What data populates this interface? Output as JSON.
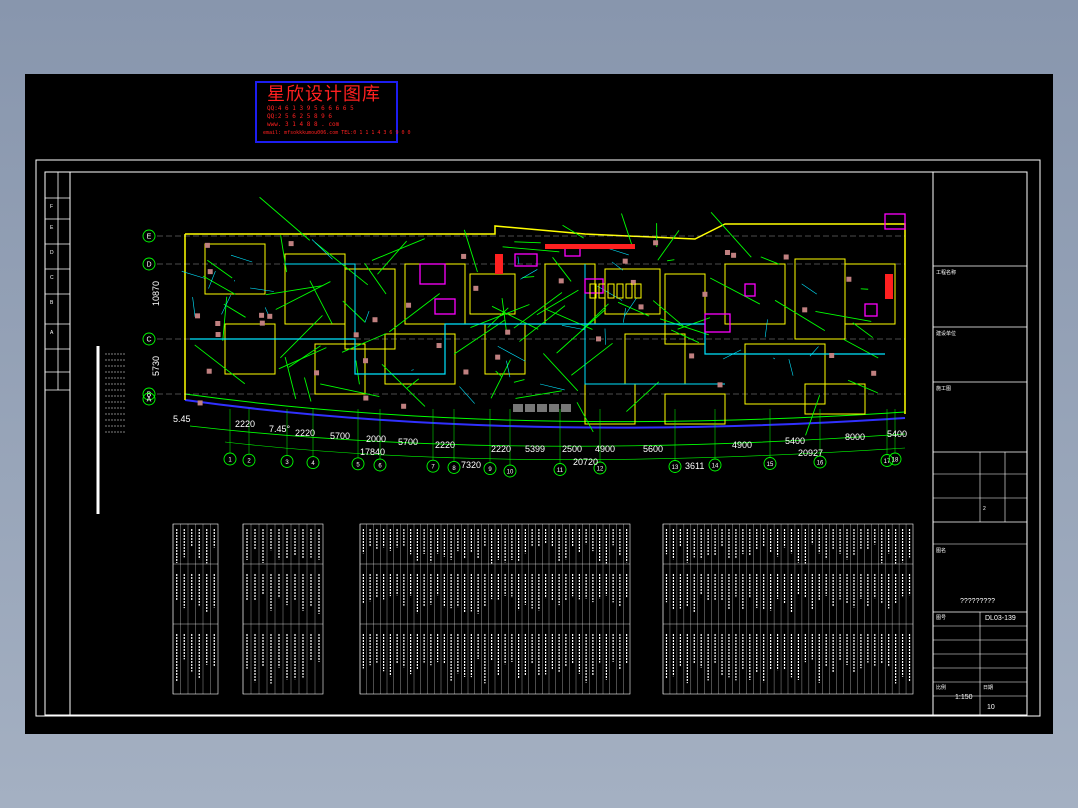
{
  "watermark": {
    "title": "星欣设计图库",
    "line1": "QQ:4 6 1 3 9 5 6 6 6 6 5",
    "line2": "QQ:2 5 6 2 5 8 9 6",
    "line3": "www. 3 1 4 8 8 . com",
    "line4": "email: mfsokkkumou006.com   TEL:0 1 1 1 4 3 6 9 0 0",
    "color": "#ff2020",
    "border_color": "#1d1df0"
  },
  "dimensions": {
    "segment_top": [
      "2220",
      "7.45°",
      "2220",
      "5700",
      "2000",
      "5700",
      "2220",
      "2220",
      "5399",
      "2500",
      "4900",
      "5600",
      "4900",
      "5400",
      "8000",
      "5400"
    ],
    "subtotals": [
      "17840",
      "7320",
      "20720",
      "3611",
      "20927"
    ],
    "left_vertical": [
      "10870",
      "5730"
    ],
    "left_small": "5.45"
  },
  "grid_axes": {
    "left": [
      "E",
      "D",
      "C",
      "B",
      "A"
    ],
    "bottom": [
      "1",
      "2",
      "3",
      "4",
      "5",
      "6",
      "7",
      "8",
      "9",
      "10",
      "11",
      "12",
      "13",
      "14",
      "15",
      "16",
      "17",
      "18"
    ]
  },
  "title_block": {
    "row_labels": [
      "F",
      "E",
      "D",
      "C",
      "B",
      "A"
    ],
    "project_label": "工程名称",
    "client_label": "建设单位",
    "drawing_label": "图名",
    "drawing_name": "?????????",
    "drawing_no_label": "图号",
    "drawing_no": "DL03-139",
    "scale_label": "比例",
    "scale": "1:150",
    "date_label": "日期",
    "sheet_no": "10",
    "stage": "施工图",
    "version": "2"
  },
  "colors": {
    "background": "#000000",
    "frame": "#ffffff",
    "wall": "#ffff00",
    "duct": "#00ff00",
    "pipe": "#00e5ff",
    "equipment": "#ff00ff",
    "fixture": "#ff2020",
    "column": "#ff80ff",
    "grid_bubble": "#00ff00"
  }
}
